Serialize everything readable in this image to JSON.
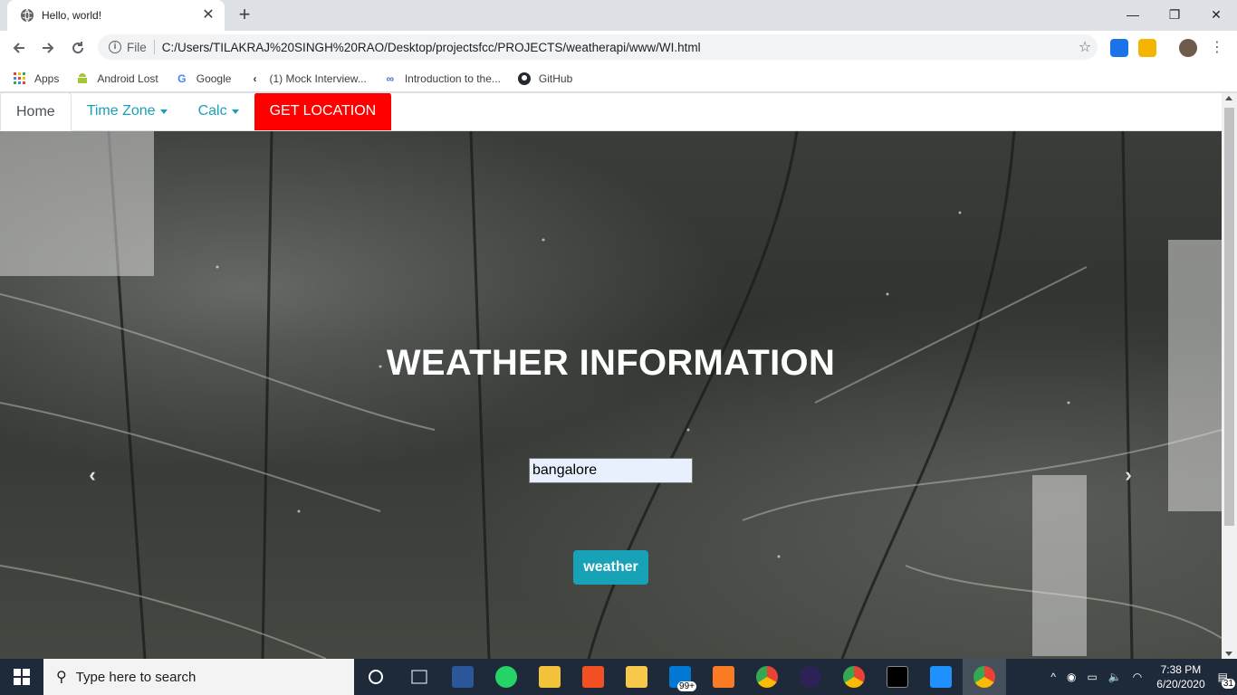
{
  "browser": {
    "tab_title": "Hello, world!",
    "omnibox_scheme_label": "File",
    "url": "C:/Users/TILAKRAJ%20SINGH%20RAO/Desktop/projectsfcc/PROJECTS/weatherapi/www/WI.html",
    "bookmarks": [
      {
        "label": "Apps",
        "icon": "apps-grid-icon"
      },
      {
        "label": "Android Lost",
        "icon": "android-icon"
      },
      {
        "label": "Google",
        "icon": "google-icon"
      },
      {
        "label": "(1) Mock Interview...",
        "icon": "bookmark-favicon-icon"
      },
      {
        "label": "Introduction to the...",
        "icon": "infinity-icon"
      },
      {
        "label": "GitHub",
        "icon": "github-icon"
      }
    ]
  },
  "page": {
    "nav": {
      "home": "Home",
      "timezone": "Time Zone",
      "calc": "Calc",
      "get_location": "GET LOCATION"
    },
    "hero_title": "WEATHER INFORMATION",
    "city_input_value": "bangalore",
    "weather_button": "weather",
    "carousel_prev": "‹",
    "carousel_next": "›"
  },
  "taskbar": {
    "search_placeholder": "Type here to search",
    "mail_badge": "99+",
    "time": "7:38 PM",
    "date": "6/20/2020",
    "notification_count": "31"
  },
  "colors": {
    "accent_info": "#17a2b8",
    "location_red": "#ff0000",
    "input_autofill": "#e8f0fe",
    "taskbar": "#1e2a3a"
  }
}
